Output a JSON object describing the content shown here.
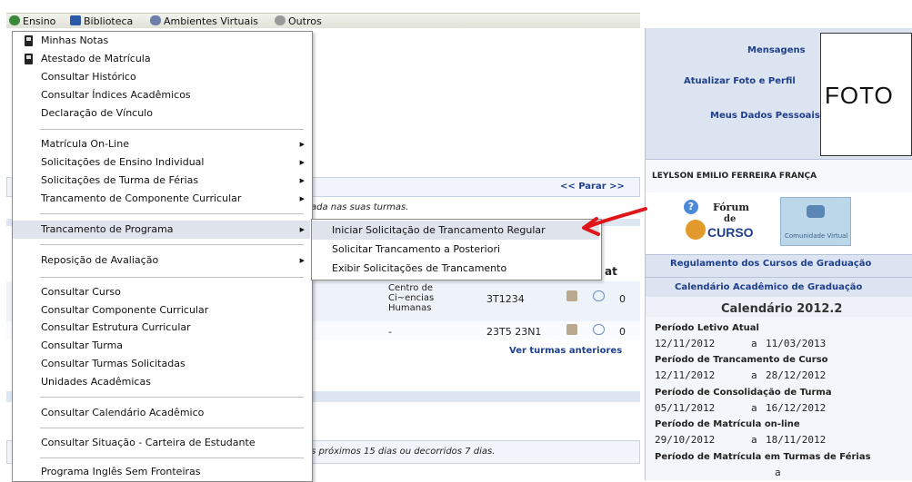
{
  "menubar": {
    "items": [
      {
        "label": "Ensino",
        "icon": "ensino-icon",
        "color": "#3a8a3a"
      },
      {
        "label": "Biblioteca",
        "icon": "book-icon",
        "color": "#2b59a8"
      },
      {
        "label": "Ambientes Virtuais",
        "icon": "virtual-env-icon",
        "color": "#6b7fa8"
      },
      {
        "label": "Outros",
        "icon": "other-icon",
        "color": "#8a8a8a"
      }
    ]
  },
  "menu": {
    "items": [
      {
        "label": "Minhas Notas",
        "icon": "document-icon"
      },
      {
        "label": "Atestado de Matrícula",
        "icon": "document-icon"
      },
      {
        "label": "Consultar Histórico"
      },
      {
        "label": "Consultar Índices Acadêmicos"
      },
      {
        "label": "Declaração de Vínculo"
      },
      {
        "label": "Matrícula On-Line",
        "submenu": true
      },
      {
        "label": "Solicitações de Ensino Individual",
        "submenu": true
      },
      {
        "label": "Solicitações de Turma de Férias",
        "submenu": true
      },
      {
        "label": "Trancamento de Componente Curricular",
        "submenu": true
      },
      {
        "label": "Trancamento de Programa",
        "submenu": true,
        "highlighted": true
      },
      {
        "label": "Reposição de Avaliação",
        "submenu": true
      },
      {
        "label": "Consultar Curso"
      },
      {
        "label": "Consultar Componente Curricular"
      },
      {
        "label": "Consultar Estrutura Curricular"
      },
      {
        "label": "Consultar Turma"
      },
      {
        "label": "Consultar Turmas Solicitadas"
      },
      {
        "label": "Unidades Acadêmicas"
      },
      {
        "label": "Consultar Calendário Acadêmico"
      },
      {
        "label": "Consultar Situação - Carteira de Estudante"
      },
      {
        "label": "Programa Inglês Sem Fronteiras"
      }
    ],
    "arrow_glyph": "▶"
  },
  "submenu": {
    "items": [
      {
        "label": "Iniciar Solicitação de Trancamento Regular",
        "highlighted": true
      },
      {
        "label": "Solicitar Trancamento a Posteriori"
      },
      {
        "label": "Exibir Solicitações de Trancamento"
      }
    ]
  },
  "main": {
    "parar_link": "<< Parar >>",
    "notice_text": "ada nas suas turmas.",
    "col_header_partial": "at",
    "rows": [
      {
        "unit": "Centro de\nCi~encias\nHumanas",
        "schedule": "3T1234",
        "count": "0"
      },
      {
        "unit": "-",
        "schedule": "23T5 23N1",
        "count": "0"
      }
    ],
    "ver_turmas_link": "Ver turmas anteriores",
    "bottom_notice": "os próximos 15 dias ou decorridos 7 dias."
  },
  "right": {
    "links": {
      "mensagens": "Mensagens",
      "atualizar": "Atualizar Foto e Perfil",
      "dados": "Meus Dados Pessoais"
    },
    "foto_label": "FOTO",
    "user_name": "LEYLSON EMILIO FERREIRA FRANÇA",
    "forum": {
      "line1": "Fórum",
      "line2": "de",
      "line3": "CURSO"
    },
    "comunidade": "Comunidade Virtual",
    "regulamento": "Regulamento dos Cursos de Graduação",
    "calendario_link": "Calendário Acadêmico de Graduação",
    "calendario_title": "Calendário 2012.2",
    "periods": [
      {
        "label": "Período Letivo Atual",
        "start": "12/11/2012",
        "end": "11/03/2013"
      },
      {
        "label": "Período de Trancamento de Curso",
        "start": "12/11/2012",
        "end": "28/12/2012"
      },
      {
        "label": "Período de Consolidação de Turma",
        "start": "05/11/2012",
        "end": "16/12/2012"
      },
      {
        "label": "Período de Matrícula on-line",
        "start": "29/10/2012",
        "end": "18/11/2012"
      },
      {
        "label": "Período de Matrícula em Turmas de Férias",
        "start": "",
        "end": ""
      }
    ],
    "date_sep": "a"
  }
}
